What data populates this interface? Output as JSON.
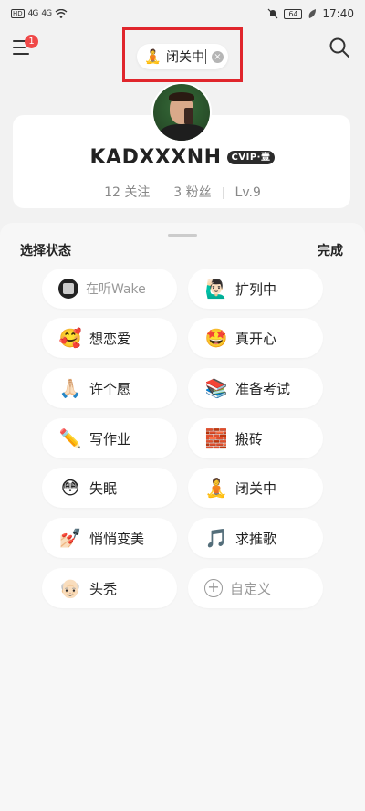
{
  "status_bar": {
    "left_icons": [
      "hd-signal-icon",
      "signal-4g-icon",
      "signal-4g-icon",
      "wifi-icon"
    ],
    "sig1": "4G",
    "sig2": "4G",
    "battery": "64",
    "time": "17:40"
  },
  "header": {
    "notification_count": "1",
    "current_status": {
      "emoji": "🧘",
      "text": "闭关中"
    }
  },
  "profile": {
    "username": "KADXXXNH",
    "vip_label": "CVIP·壹",
    "following": "12 关注",
    "followers": "3 粉丝",
    "level": "Lv.9"
  },
  "sheet": {
    "title": "选择状态",
    "done": "完成",
    "items": [
      {
        "emoji": "",
        "label": "在听Wake"
      },
      {
        "emoji": "🙋🏻‍♂️",
        "label": "扩列中"
      },
      {
        "emoji": "🥰",
        "label": "想恋爱"
      },
      {
        "emoji": "🤩",
        "label": "真开心"
      },
      {
        "emoji": "🙏🏻",
        "label": "许个愿"
      },
      {
        "emoji": "📚",
        "label": "准备考试"
      },
      {
        "emoji": "✏️",
        "label": "写作业"
      },
      {
        "emoji": "🧱",
        "label": "搬砖"
      },
      {
        "emoji": "😳",
        "label": "失眠"
      },
      {
        "emoji": "🧘",
        "label": "闭关中"
      },
      {
        "emoji": "💅🏻",
        "label": "悄悄变美"
      },
      {
        "emoji": "🎵",
        "label": "求推歌"
      },
      {
        "emoji": "👴🏻",
        "label": "头秃"
      },
      {
        "emoji": "＋",
        "label": "自定义"
      }
    ]
  }
}
